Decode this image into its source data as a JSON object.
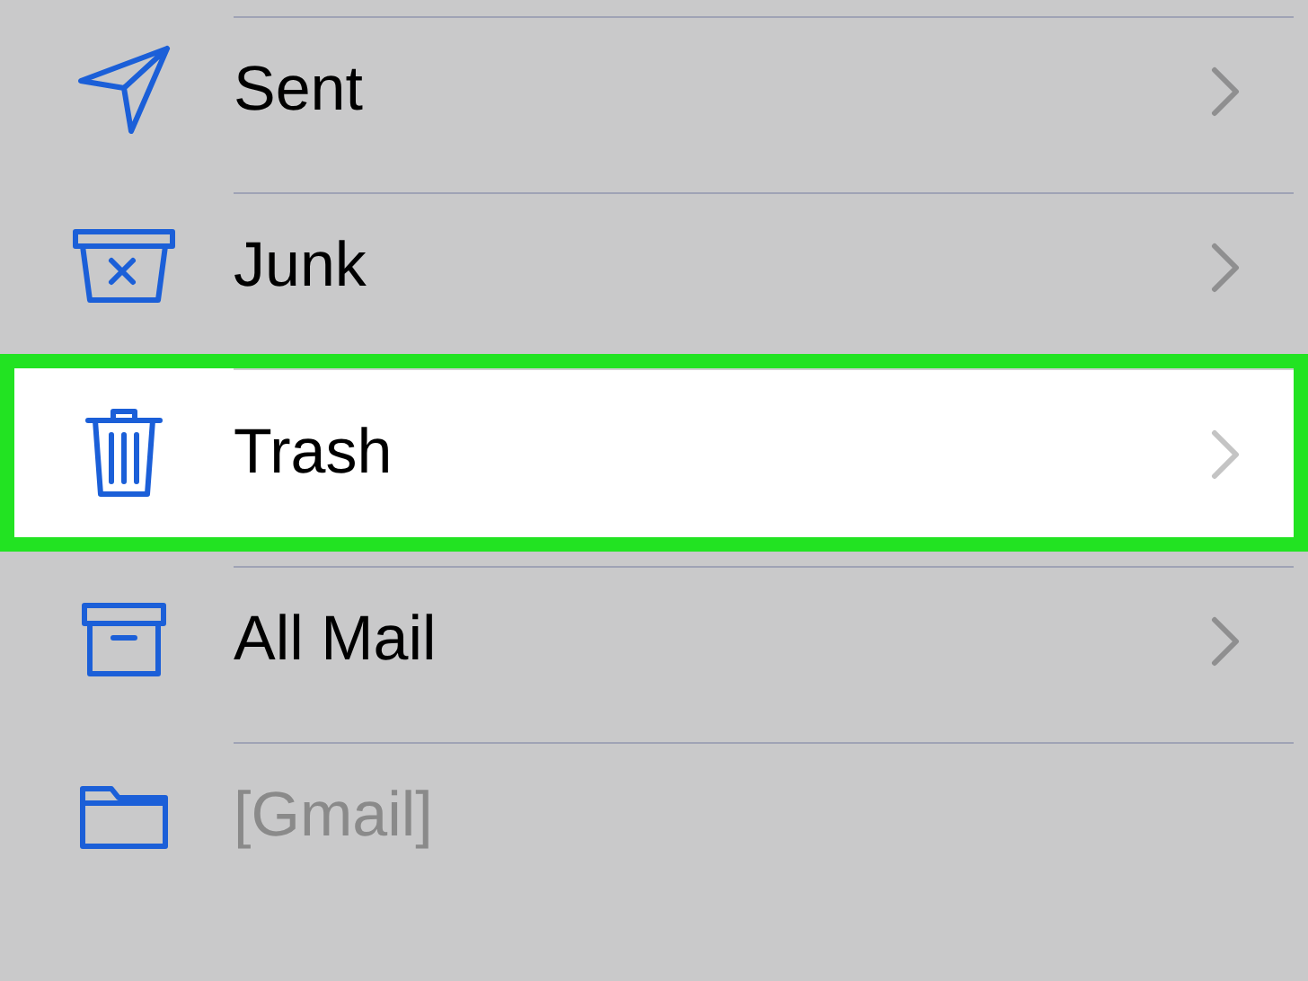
{
  "folders": [
    {
      "kind": "sent",
      "label": "Sent",
      "selected": false,
      "disabled": false
    },
    {
      "kind": "junk",
      "label": "Junk",
      "selected": false,
      "disabled": false
    },
    {
      "kind": "trash",
      "label": "Trash",
      "selected": true,
      "disabled": false
    },
    {
      "kind": "archive",
      "label": "All Mail",
      "selected": false,
      "disabled": false
    },
    {
      "kind": "folder",
      "label": "[Gmail]",
      "selected": false,
      "disabled": true
    }
  ]
}
